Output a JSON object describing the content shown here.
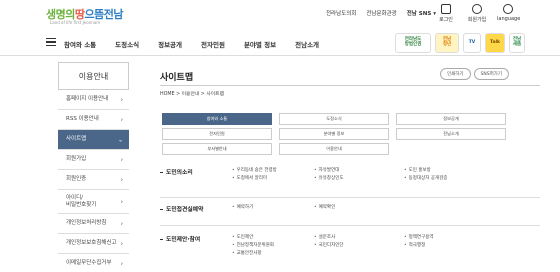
{
  "logo": {
    "part1": "생명의",
    "part2": "땅",
    "part3": "으뜸전남",
    "sub": "Land of life first Jeonnam"
  },
  "top_links": [
    "전라남도의회",
    "전남문화관광",
    "전남 SNS"
  ],
  "top_icons": [
    {
      "icon": "lock-icon",
      "label": "로그인"
    },
    {
      "icon": "user-icon",
      "label": "회원가입"
    },
    {
      "icon": "globe-icon",
      "label": "language"
    }
  ],
  "gnb": [
    "참여와 소통",
    "도정소식",
    "정보공개",
    "전자민원",
    "분야별 정보",
    "전남소개"
  ],
  "banners": [
    {
      "text": "전라남도\n방범인권",
      "bg": "#ffffff",
      "fg": "#2a7f3a",
      "w": 36
    },
    {
      "text": "전남\n청년",
      "bg": "#fff4c2",
      "fg": "#e07b00",
      "w": 24
    },
    {
      "text": "TV",
      "bg": "#ffffff",
      "fg": "#1d5aa8",
      "w": 18
    },
    {
      "text": "Talk",
      "bg": "#ffd84a",
      "fg": "#7a4a00",
      "w": 20
    },
    {
      "text": "전남\n새뜸",
      "bg": "#ffffff",
      "fg": "#2a8a4a",
      "w": 16
    }
  ],
  "lnb": {
    "title": "이용안내",
    "items": [
      {
        "label": "홈페이지 이용안내",
        "h": 20,
        "active": false
      },
      {
        "label": "RSS 이용안내",
        "h": 20,
        "active": false
      },
      {
        "label": "사이트맵",
        "h": 20,
        "active": true
      },
      {
        "label": "회원가입",
        "h": 20,
        "active": false
      },
      {
        "label": "회원인증",
        "h": 20,
        "active": false
      },
      {
        "label": "아이디/\n비밀번호찾기",
        "h": 24,
        "active": false
      },
      {
        "label": "개인정보처리방침",
        "h": 20,
        "active": false
      },
      {
        "label": "개인정보보호침해신고",
        "h": 20,
        "active": false
      },
      {
        "label": "이메일무단수집거부",
        "h": 20,
        "active": false
      }
    ]
  },
  "content": {
    "title": "사이트맵",
    "buttons": [
      "인쇄하기",
      "SNS퍼가기"
    ],
    "breadcrumb": "HOME > 이용안내 > 사이트맵",
    "tabs": [
      {
        "label": "참여와 소통",
        "active": true
      },
      {
        "label": "도정소식",
        "active": false
      },
      {
        "label": "정보공개",
        "active": false
      },
      {
        "label": "전자민원",
        "active": false
      },
      {
        "label": "분야별 정보",
        "active": false
      },
      {
        "label": "전남소개",
        "active": false
      },
      {
        "label": "부서별안내",
        "active": false
      },
      {
        "label": "이용안내",
        "active": false
      }
    ],
    "sections": [
      {
        "title": "도민의소리",
        "links": [
          "우리동네 숨은 전령방",
          "자유발언대",
          "도민 홍보방",
          "도청에서 알리미",
          "유유창상인도",
          "동정대상자 공개검증"
        ]
      },
      {
        "title": "도민접견실예약",
        "links": [
          "예약하기",
          "예약확인"
        ]
      },
      {
        "title": "도민제안·참여",
        "links": [
          "도민제안",
          "설문조사",
          "정책연구용역",
          "전남정책자문위원회",
          "국민디자인단",
          "적극행정",
          "교통안전사항"
        ]
      }
    ]
  }
}
